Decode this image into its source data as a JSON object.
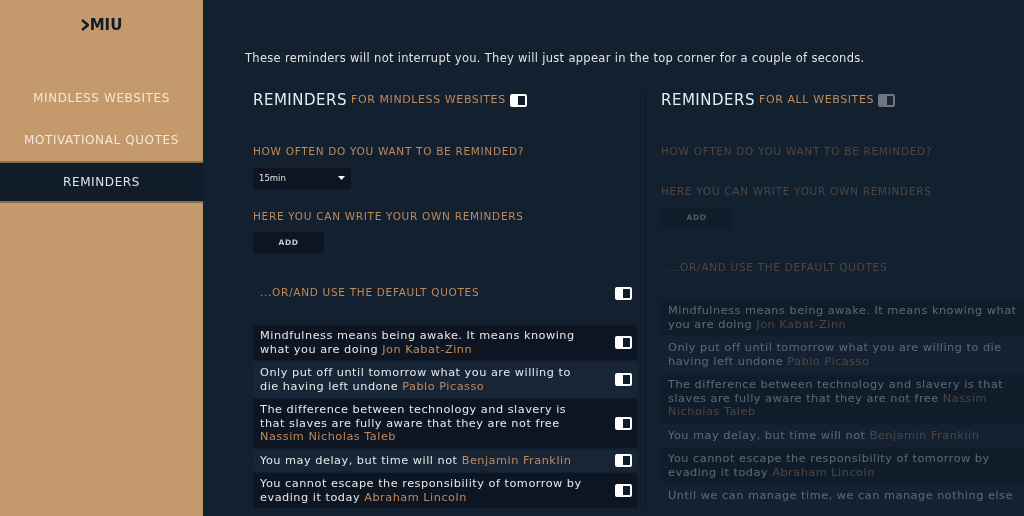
{
  "sidebar": {
    "logo": "MIU",
    "items": [
      {
        "label": "MINDLESS WEBSITES",
        "selected": false
      },
      {
        "label": "MOTIVATIONAL QUOTES",
        "selected": false
      },
      {
        "label": "REMINDERS",
        "selected": true
      }
    ]
  },
  "intro": "These reminders will not interrupt you. They will just appear in the top corner for a couple of seconds.",
  "panels": [
    {
      "title": "REMINDERS",
      "subtitle": "FOR MINDLESS WEBSITES",
      "on": true,
      "enabled": true,
      "frequency_label": "HOW OFTEN DO YOU WANT TO BE REMINDED?",
      "frequency": "15min",
      "write_label": "HERE YOU CAN WRITE YOUR OWN REMINDERS",
      "add_button": "ADD",
      "quotes_label": "...OR/AND USE THE DEFAULT QUOTES",
      "quotes_on": true,
      "quotes": [
        {
          "text": "Mindfulness means being awake. It means knowing what you are doing",
          "author": "Jon Kabat-Zinn",
          "on": true
        },
        {
          "text": "Only put off until tomorrow what you are willing to die having left undone",
          "author": "Pablo Picasso",
          "on": true
        },
        {
          "text": "The difference between technology and slavery is that slaves are fully aware that they are not free",
          "author": "Nassim Nicholas Taleb",
          "on": true
        },
        {
          "text": "You may delay, but time will not",
          "author": "Benjamin Franklin",
          "on": true
        },
        {
          "text": "You cannot escape the responsibility of tomorrow by evading it today",
          "author": "Abraham Lincoln",
          "on": true
        }
      ]
    },
    {
      "title": "REMINDERS",
      "subtitle": "FOR ALL WEBSITES",
      "on": false,
      "enabled": false,
      "frequency_label": "HOW OFTEN DO YOU WANT TO BE REMINDED?",
      "write_label": "HERE YOU CAN WRITE YOUR OWN REMINDERS",
      "add_button": "ADD",
      "quotes_label": "...OR/AND USE THE DEFAULT QUOTES",
      "quotes": [
        {
          "text": "Mindfulness means being awake. It means knowing what you are doing",
          "author": "Jon Kabat-Zinn"
        },
        {
          "text": "Only put off until tomorrow what you are willing to die having left undone",
          "author": "Pablo Picasso"
        },
        {
          "text": "The difference between technology and slavery is that slaves are fully aware that they are not free",
          "author": "Nassim Nicholas Taleb"
        },
        {
          "text": "You may delay, but time will not",
          "author": "Benjamin Franklin"
        },
        {
          "text": "You cannot escape the responsibility of tomorrow by evading it today",
          "author": "Abraham Lincoln"
        },
        {
          "text": "Until we can manage time, we can manage nothing else"
        }
      ]
    }
  ]
}
